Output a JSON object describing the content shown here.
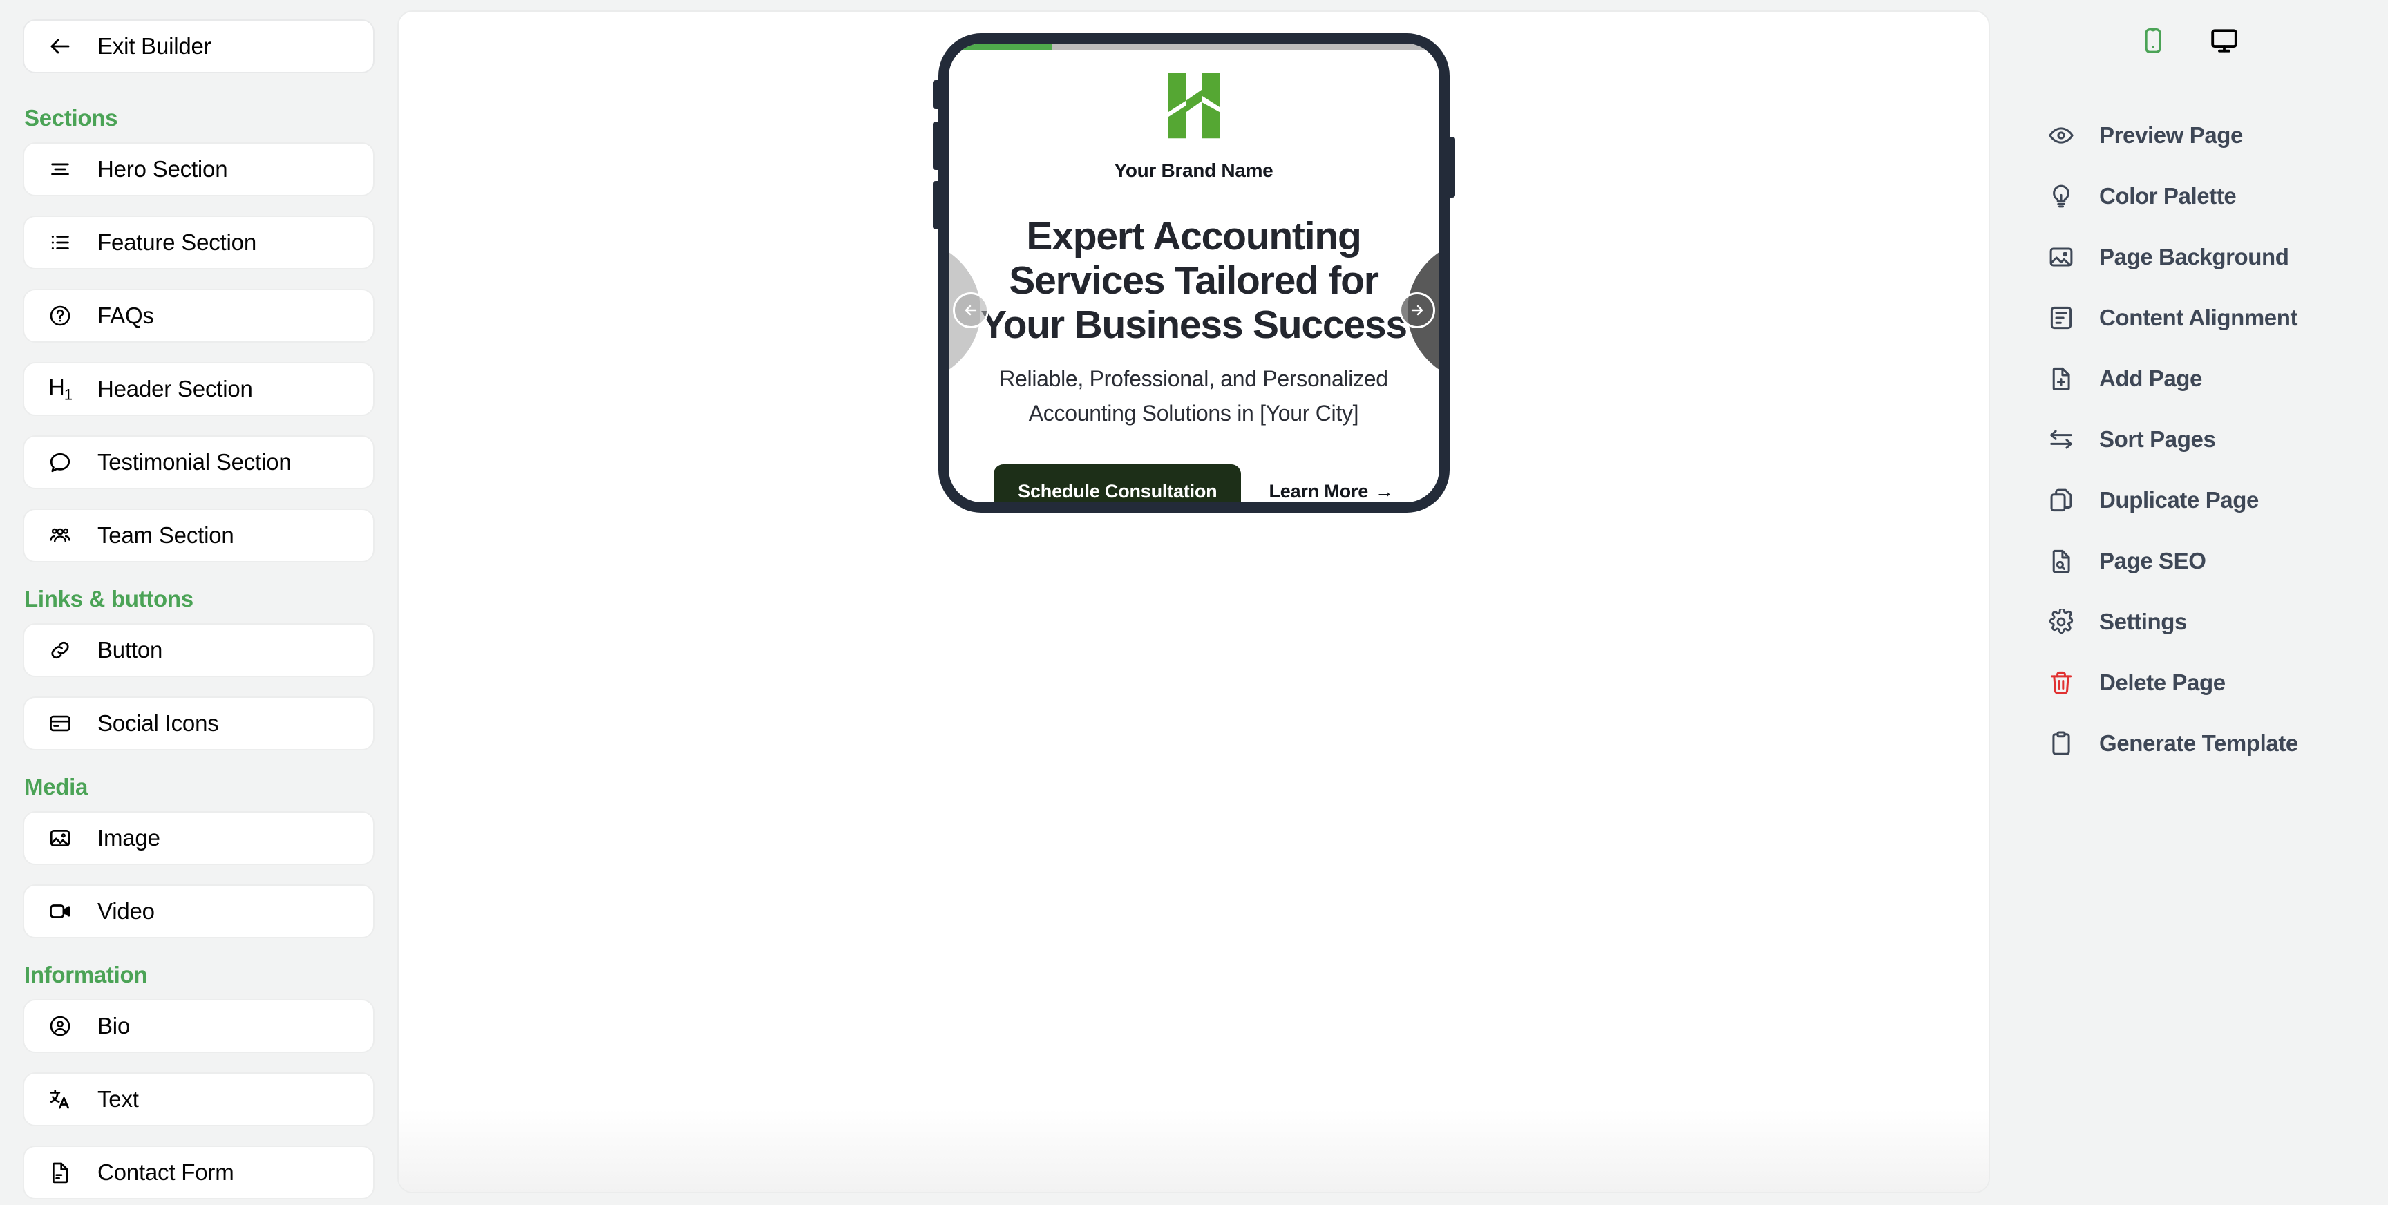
{
  "sidebar": {
    "exit": {
      "label": "Exit Builder",
      "icon": "arrow-left-icon"
    },
    "groups": [
      {
        "title": "Sections",
        "items": [
          {
            "label": "Hero Section",
            "icon": "align-center-icon"
          },
          {
            "label": "Feature Section",
            "icon": "list-icon"
          },
          {
            "label": "FAQs",
            "icon": "question-circle-icon"
          },
          {
            "label": "Header Section",
            "icon": "heading-h1-icon"
          },
          {
            "label": "Testimonial Section",
            "icon": "chat-bubble-icon"
          },
          {
            "label": "Team Section",
            "icon": "users-group-icon"
          }
        ]
      },
      {
        "title": "Links & buttons",
        "items": [
          {
            "label": "Button",
            "icon": "link-chain-icon"
          },
          {
            "label": "Social Icons",
            "icon": "card-icon"
          }
        ]
      },
      {
        "title": "Media",
        "items": [
          {
            "label": "Image",
            "icon": "image-icon"
          },
          {
            "label": "Video",
            "icon": "video-camera-icon"
          }
        ]
      },
      {
        "title": "Information",
        "items": [
          {
            "label": "Bio",
            "icon": "user-circle-icon"
          },
          {
            "label": "Text",
            "icon": "translate-text-icon"
          },
          {
            "label": "Contact Form",
            "icon": "document-lines-icon"
          }
        ]
      }
    ]
  },
  "preview": {
    "progress_percent": 21,
    "brand_name": "Your Brand Name",
    "hero_title": "Expert Accounting Services Tailored for Your Business Success",
    "hero_subtitle": "Reliable, Professional, and Personalized Accounting Solutions in [Your City]",
    "cta_primary": "Schedule Consultation",
    "cta_secondary": "Learn More",
    "cta_secondary_arrow": "→",
    "prev_arrow_icon": "arrow-left-circle-icon",
    "next_arrow_icon": "arrow-right-circle-icon",
    "logo_icon": "brand-h-logo-icon"
  },
  "rightpanel": {
    "device_toggle": [
      {
        "name": "mobile",
        "icon": "mobile-phone-icon",
        "active": true
      },
      {
        "name": "desktop",
        "icon": "desktop-monitor-icon",
        "active": false
      }
    ],
    "actions": [
      {
        "label": "Preview Page",
        "icon": "eye-icon"
      },
      {
        "label": "Color Palette",
        "icon": "lightbulb-icon"
      },
      {
        "label": "Page Background",
        "icon": "image-icon"
      },
      {
        "label": "Content Alignment",
        "icon": "align-document-icon"
      },
      {
        "label": "Add Page",
        "icon": "document-plus-icon"
      },
      {
        "label": "Sort Pages",
        "icon": "sort-arrows-icon"
      },
      {
        "label": "Duplicate Page",
        "icon": "copy-icon"
      },
      {
        "label": "Page SEO",
        "icon": "document-search-icon"
      },
      {
        "label": "Settings",
        "icon": "gear-icon"
      },
      {
        "label": "Delete Page",
        "icon": "trash-icon"
      },
      {
        "label": "Generate Template",
        "icon": "clipboard-icon"
      }
    ]
  },
  "colors": {
    "accent_green": "#4ba356",
    "brand_green": "#55a733",
    "phone_frame": "#232b39",
    "cta_dark_green": "#1d2f18",
    "danger_red": "#e03131",
    "panel_bg": "#f2f3f3",
    "text_slate": "#3e4756"
  }
}
